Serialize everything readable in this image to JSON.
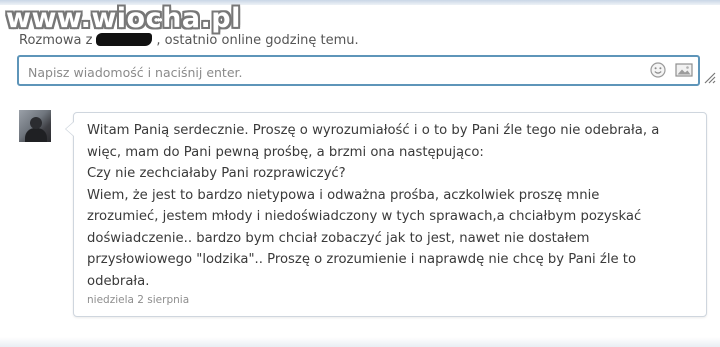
{
  "watermark": "www.wiocha.pl",
  "header": {
    "prefix": "Rozmowa z",
    "suffix": ", ostatnio online godzinę temu."
  },
  "composer": {
    "placeholder": "Napisz wiadomość i naciśnij enter.",
    "icons": [
      "smiley-icon",
      "image-icon"
    ]
  },
  "message": {
    "lines": [
      "Witam Panią serdecznie. Proszę o wyrozumiałość i o to by Pani źle tego nie odebrała, a",
      "więc, mam do Pani pewną prośbę, a brzmi ona następująco:",
      "Czy nie zechciałaby Pani rozprawiczyć?",
      "Wiem, że jest to bardzo nietypowa i odważna prośba, aczkolwiek proszę mnie",
      "zrozumieć, jestem młody i niedoświadczony w tych sprawach,a chciałbym pozyskać",
      "doświadczenie.. bardzo bym chciał zobaczyć jak to jest, nawet nie dostałem",
      "przysłowiowego \"lodzika\".. Proszę o zrozumienie i naprawdę nie chcę by Pani źle to",
      "odebrała."
    ],
    "timestamp": "niedziela 2 sierpnia"
  },
  "colors": {
    "composer_border": "#5e95b9",
    "text": "#3a3a3a",
    "muted": "#8e8e8e"
  }
}
